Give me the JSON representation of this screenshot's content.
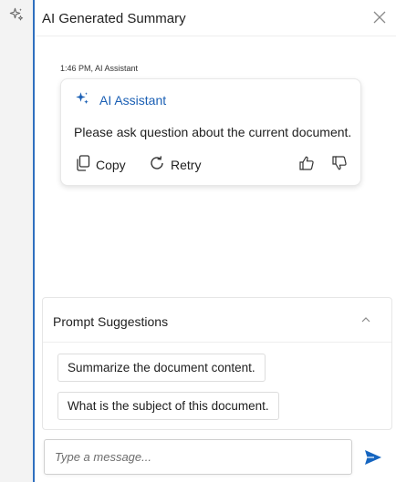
{
  "header": {
    "title": "AI Generated Summary",
    "close_icon": "close-icon"
  },
  "rail": {
    "icon": "sparkle-icon"
  },
  "message": {
    "meta": "1:46 PM, AI Assistant",
    "author": "AI Assistant",
    "author_icon": "sparkle-icon",
    "text": "Please ask question about the current document.",
    "actions": {
      "copy_label": "Copy",
      "retry_label": "Retry",
      "thumbs_up_icon": "thumbs-up-icon",
      "thumbs_down_icon": "thumbs-down-icon"
    }
  },
  "suggestions": {
    "title": "Prompt Suggestions",
    "expanded": true,
    "items": [
      "Summarize the document content.",
      "What is the subject of this document."
    ]
  },
  "composer": {
    "placeholder": "Type a message...",
    "value": "",
    "send_icon": "send-icon"
  },
  "colors": {
    "accent": "#1a5fb4",
    "rail_bg": "#f3f3f3",
    "rail_border": "#2f6fbf",
    "send": "#1565c0"
  }
}
